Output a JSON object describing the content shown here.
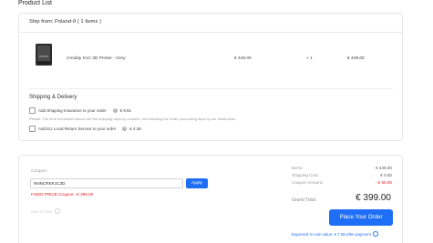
{
  "page_title": "Product List",
  "shipment": {
    "header": "Ship from: Poland-9 ( 1 Items )",
    "item": {
      "name": "Creality K1C 3D Printer - Grey",
      "price": "€ 449.00",
      "qty": "× 1",
      "total": "€ 449.00"
    }
  },
  "shipping_delivery": {
    "title": "Shipping & Delivery",
    "options": [
      {
        "label": "Add Shipping Insurance to your order",
        "price": "€ 9.91"
      },
      {
        "label": "Add EU Local Return Service to your order",
        "price": "€ 4.38"
      }
    ],
    "note": "Please: The time mentioned above are the shipping days by couriers, not including the order processing days by our warehouse."
  },
  "coupon": {
    "label": "Coupon:",
    "value": "NNNCREK1C3D",
    "apply_label": "Apply",
    "applied_text": "FIXED PRICE Coupon: -€ 399.00",
    "faded_label": "Use G-coin"
  },
  "summary": {
    "items_label": "Items:",
    "items_value": "€ 449.00",
    "shipping_label": "Shipping Cost:",
    "shipping_value": "€ 0.00",
    "coupon_label": "Coupon Amount:",
    "coupon_value": "- € 50.00",
    "grand_label": "Grand Total:",
    "grand_value": "€ 399.00",
    "order_button": "Place Your Order",
    "gcoin_text": "Expected G-coin value: € 7.98 after payment"
  },
  "colors": {
    "accent": "#1e6ff5",
    "danger": "#e02020"
  }
}
